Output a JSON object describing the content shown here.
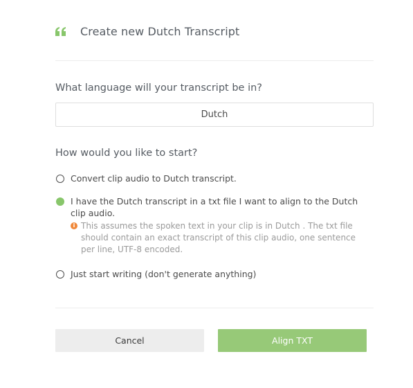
{
  "dialog": {
    "title": "Create new Dutch Transcript",
    "icon": "quote-icon"
  },
  "language": {
    "question": "What language will your transcript be in?",
    "selected": "Dutch"
  },
  "start": {
    "question": "How would you like to start?",
    "options": [
      {
        "label": "Convert clip audio to Dutch transcript.",
        "checked": false
      },
      {
        "label": "I have the Dutch transcript in a txt file I want to align to the Dutch clip audio.",
        "checked": true,
        "note": "This assumes the spoken text in your clip is in Dutch . The txt file should contain an exact transcript of this clip audio, one sentence per line, UTF-8 encoded.",
        "note_icon": "info-icon"
      },
      {
        "label": "Just start writing (don't generate anything)",
        "checked": false
      }
    ]
  },
  "buttons": {
    "cancel": "Cancel",
    "align": "Align TXT"
  },
  "colors": {
    "accent_green": "#88c66b",
    "button_green": "#97c978",
    "info_orange": "#f0883a",
    "cancel_bg": "#ededed"
  }
}
